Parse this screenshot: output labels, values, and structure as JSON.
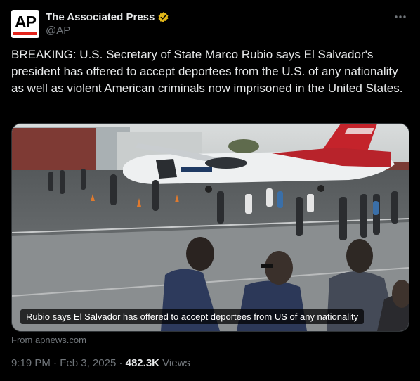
{
  "author": {
    "name": "The Associated Press",
    "handle": "@AP",
    "avatar_text": "AP"
  },
  "post": {
    "text": "BREAKING: U.S. Secretary of State Marco Rubio says El Salvador's president has offered to accept deportees from the U.S. of any nationality as well as violent American criminals now imprisoned in the United States.",
    "media_caption": "Rubio says El Salvador has offered to accept deportees from US of any nationality",
    "source": "From apnews.com",
    "time": "9:19 PM",
    "date": "Feb 3, 2025",
    "separator": "·",
    "views_count": "482.3K",
    "views_label": "Views"
  },
  "icons": {
    "more": "more-options-icon",
    "verified": "verified-badge-icon"
  },
  "colors": {
    "background": "#000000",
    "text": "#e7e9ea",
    "secondary": "#71767b",
    "verified_gold": "#e2b719",
    "ap_red": "#e3231b"
  }
}
